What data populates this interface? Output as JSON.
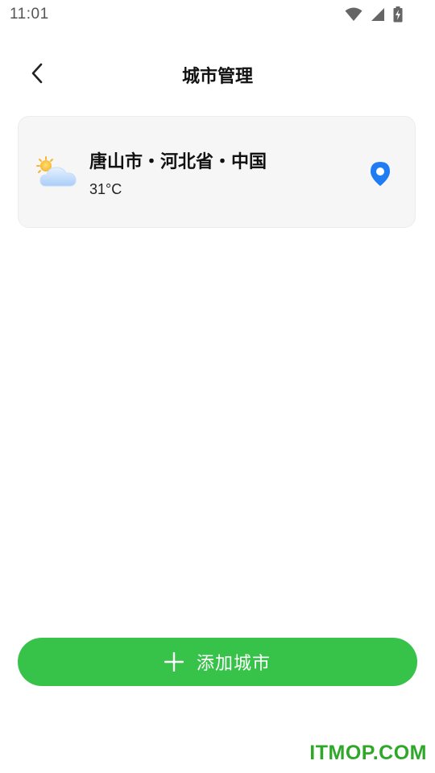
{
  "status_bar": {
    "time": "11:01",
    "icons": [
      "wifi-icon",
      "cellular-signal-icon",
      "battery-charging-icon"
    ]
  },
  "header": {
    "back_icon": "chevron-left-icon",
    "title": "城市管理"
  },
  "city_list": [
    {
      "weather_icon": "partly-cloudy-icon",
      "name": "唐山市・河北省・中国",
      "temperature": "31°C",
      "location_icon": "location-pin-icon"
    }
  ],
  "add_city": {
    "icon": "plus-icon",
    "label": "添加城市"
  },
  "watermark": "ITMOP.COM",
  "colors": {
    "accent_green": "#37c24a",
    "location_blue": "#1f7cf2",
    "card_background": "#f6f6f6",
    "watermark_green": "#2fa82a"
  }
}
